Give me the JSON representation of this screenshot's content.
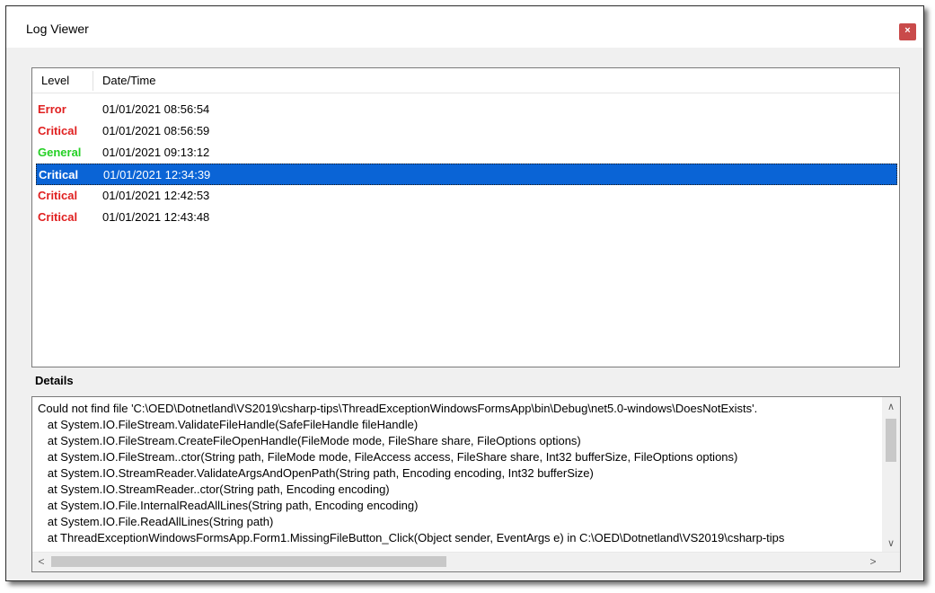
{
  "window": {
    "title": "Log Viewer",
    "close_label": "×"
  },
  "list": {
    "columns": [
      "Level",
      "Date/Time"
    ],
    "rows": [
      {
        "level": "Error",
        "datetime": "01/01/2021 08:56:54",
        "selected": false
      },
      {
        "level": "Critical",
        "datetime": "01/01/2021 08:56:59",
        "selected": false
      },
      {
        "level": "General",
        "datetime": "01/01/2021 09:13:12",
        "selected": false
      },
      {
        "level": "Critical",
        "datetime": "01/01/2021 12:34:39",
        "selected": true
      },
      {
        "level": "Critical",
        "datetime": "01/01/2021 12:42:53",
        "selected": false
      },
      {
        "level": "Critical",
        "datetime": "01/01/2021 12:43:48",
        "selected": false
      }
    ]
  },
  "details": {
    "label": "Details",
    "text": "Could not find file 'C:\\OED\\Dotnetland\\VS2019\\csharp-tips\\ThreadExceptionWindowsFormsApp\\bin\\Debug\\net5.0-windows\\DoesNotExists'.\n   at System.IO.FileStream.ValidateFileHandle(SafeFileHandle fileHandle)\n   at System.IO.FileStream.CreateFileOpenHandle(FileMode mode, FileShare share, FileOptions options)\n   at System.IO.FileStream..ctor(String path, FileMode mode, FileAccess access, FileShare share, Int32 bufferSize, FileOptions options)\n   at System.IO.StreamReader.ValidateArgsAndOpenPath(String path, Encoding encoding, Int32 bufferSize)\n   at System.IO.StreamReader..ctor(String path, Encoding encoding)\n   at System.IO.File.InternalReadAllLines(String path, Encoding encoding)\n   at System.IO.File.ReadAllLines(String path)\n   at ThreadExceptionWindowsFormsApp.Form1.MissingFileButton_Click(Object sender, EventArgs e) in C:\\OED\\Dotnetland\\VS2019\\csharp-tips"
  },
  "scroll_glyphs": {
    "up": "∧",
    "down": "∨",
    "left": "<",
    "right": ">"
  },
  "colors": {
    "error": "#e02020",
    "critical": "#e02020",
    "general": "#25d025",
    "selection": "#0a64d6",
    "close_button": "#c94a4a"
  }
}
